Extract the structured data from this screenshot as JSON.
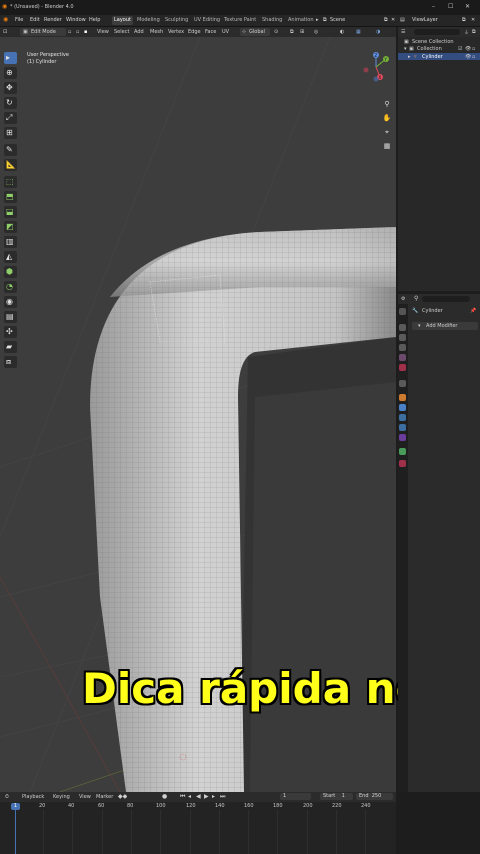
{
  "window": {
    "title": "* (Unsaved) - Blender 4.0"
  },
  "menu": {
    "items": [
      "File",
      "Edit",
      "Render",
      "Window",
      "Help"
    ]
  },
  "workspaces": [
    "Layout",
    "Modeling",
    "Sculpting",
    "UV Editing",
    "Texture Paint",
    "Shading",
    "Animation"
  ],
  "scene": {
    "label": "Scene",
    "view_layer": "ViewLayer"
  },
  "viewport_header": {
    "mode": "Edit Mode",
    "menus": [
      "View",
      "Select",
      "Add",
      "Mesh",
      "Vertex",
      "Edge",
      "Face",
      "UV"
    ],
    "orientation": "Global",
    "options": "Options"
  },
  "viewport": {
    "perspective": "User Perspective",
    "object": "(1) Cylinder"
  },
  "gizmo": {
    "z": "Z",
    "y": "Y",
    "x": "X"
  },
  "outliner": {
    "root": "Scene Collection",
    "collection": "Collection",
    "item": "Cylinder"
  },
  "properties": {
    "object_name": "Cylinder",
    "add_modifier": "Add Modifier"
  },
  "timeline": {
    "menus": [
      "Playback",
      "Keying",
      "View",
      "Marker"
    ],
    "current_frame": "1",
    "frame_field": "1",
    "start_label": "Start",
    "start_value": "1",
    "end_label": "End",
    "end_value": "250",
    "ticks": [
      "20",
      "40",
      "60",
      "80",
      "100",
      "120",
      "140",
      "160",
      "180",
      "200",
      "220",
      "240"
    ]
  },
  "caption": "Dica rápida no"
}
